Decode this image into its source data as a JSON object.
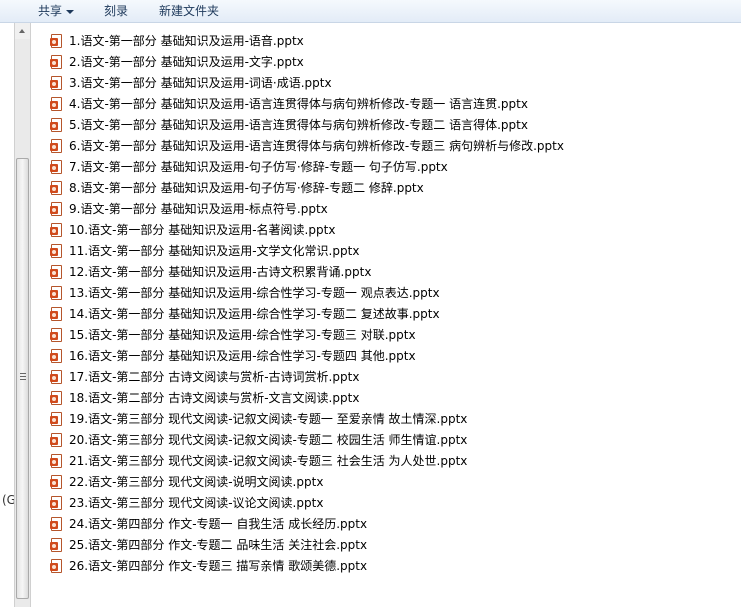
{
  "toolbar": {
    "share_label": "共享",
    "burn_label": "刻录",
    "new_folder_label": "新建文件夹"
  },
  "left_pane": {
    "cut_text": "(G"
  },
  "icon": "powerpoint-file-icon",
  "accent": "#d04a1c",
  "files": [
    "1.语文-第一部分 基础知识及运用-语音.pptx",
    "2.语文-第一部分 基础知识及运用-文字.pptx",
    "3.语文-第一部分 基础知识及运用-词语·成语.pptx",
    "4.语文-第一部分 基础知识及运用-语言连贯得体与病句辨析修改-专题一  语言连贯.pptx",
    "5.语文-第一部分 基础知识及运用-语言连贯得体与病句辨析修改-专题二  语言得体.pptx",
    "6.语文-第一部分 基础知识及运用-语言连贯得体与病句辨析修改-专题三  病句辨析与修改.pptx",
    "7.语文-第一部分 基础知识及运用-句子仿写·修辞-专题一  句子仿写.pptx",
    "8.语文-第一部分 基础知识及运用-句子仿写·修辞-专题二  修辞.pptx",
    "9.语文-第一部分 基础知识及运用-标点符号.pptx",
    "10.语文-第一部分 基础知识及运用-名著阅读.pptx",
    "11.语文-第一部分 基础知识及运用-文学文化常识.pptx",
    "12.语文-第一部分 基础知识及运用-古诗文积累背诵.pptx",
    "13.语文-第一部分 基础知识及运用-综合性学习-专题一  观点表达.pptx",
    "14.语文-第一部分 基础知识及运用-综合性学习-专题二  复述故事.pptx",
    "15.语文-第一部分 基础知识及运用-综合性学习-专题三  对联.pptx",
    "16.语文-第一部分 基础知识及运用-综合性学习-专题四  其他.pptx",
    "17.语文-第二部分  古诗文阅读与赏析-古诗词赏析.pptx",
    "18.语文-第二部分  古诗文阅读与赏析-文言文阅读.pptx",
    "19.语文-第三部分 现代文阅读-记叙文阅读-专题一  至爱亲情  故土情深.pptx",
    "20.语文-第三部分 现代文阅读-记叙文阅读-专题二  校园生活  师生情谊.pptx",
    "21.语文-第三部分 现代文阅读-记叙文阅读-专题三  社会生活  为人处世.pptx",
    "22.语文-第三部分 现代文阅读-说明文阅读.pptx",
    "23.语文-第三部分 现代文阅读-议论文阅读.pptx",
    "24.语文-第四部分 作文-专题一  自我生活  成长经历.pptx",
    "25.语文-第四部分 作文-专题二  品味生活  关注社会.pptx",
    "26.语文-第四部分 作文-专题三  描写亲情  歌颂美德.pptx"
  ]
}
